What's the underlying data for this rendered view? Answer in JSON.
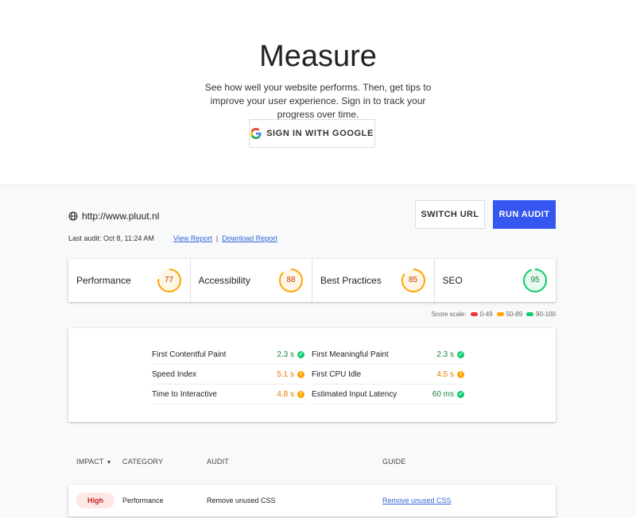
{
  "hero": {
    "title": "Measure",
    "description": "See how well your website performs. Then, get tips to improve your user experience. Sign in to track your progress over time.",
    "signin_label": "SIGN IN WITH GOOGLE"
  },
  "report": {
    "url": "http://www.pluut.nl",
    "last_audit": "Last audit: Oct 8, 11:24 AM",
    "view_report": "View Report",
    "separator": "|",
    "download_report": "Download Report",
    "switch_url": "SWITCH URL",
    "run_audit": "RUN AUDIT"
  },
  "scores": [
    {
      "label": "Performance",
      "value": "77",
      "status": "average",
      "color": "#ffa400"
    },
    {
      "label": "Accessibility",
      "value": "88",
      "status": "average",
      "color": "#ffa400"
    },
    {
      "label": "Best Practices",
      "value": "85",
      "status": "average",
      "color": "#ffa400"
    },
    {
      "label": "SEO",
      "value": "95",
      "status": "good",
      "color": "#0cce6b"
    }
  ],
  "scale": {
    "label": "Score scale:",
    "ranges": [
      {
        "label": "0-49",
        "color": "#e53935"
      },
      {
        "label": "50-89",
        "color": "#ffa400"
      },
      {
        "label": "90-100",
        "color": "#0cce6b"
      }
    ]
  },
  "metrics": [
    {
      "label": "First Contentful Paint",
      "value": "2.3 s",
      "status": "good"
    },
    {
      "label": "First Meaningful Paint",
      "value": "2.3 s",
      "status": "good"
    },
    {
      "label": "Speed Index",
      "value": "5.1 s",
      "status": "average"
    },
    {
      "label": "First CPU Idle",
      "value": "4.5 s",
      "status": "average"
    },
    {
      "label": "Time to Interactive",
      "value": "4.8 s",
      "status": "average"
    },
    {
      "label": "Estimated Input Latency",
      "value": "60 ms",
      "status": "good"
    }
  ],
  "table": {
    "headers": {
      "impact": "IMPACT",
      "category": "CATEGORY",
      "audit": "AUDIT",
      "guide": "GUIDE"
    },
    "rows": [
      {
        "impact": "High",
        "category": "Performance",
        "audit": "Remove unused CSS",
        "guide": "Remove unused CSS"
      }
    ]
  },
  "colors": {
    "accent": "#3556ef",
    "good": "#0cce6b",
    "average": "#ffa400",
    "poor": "#e53935"
  }
}
